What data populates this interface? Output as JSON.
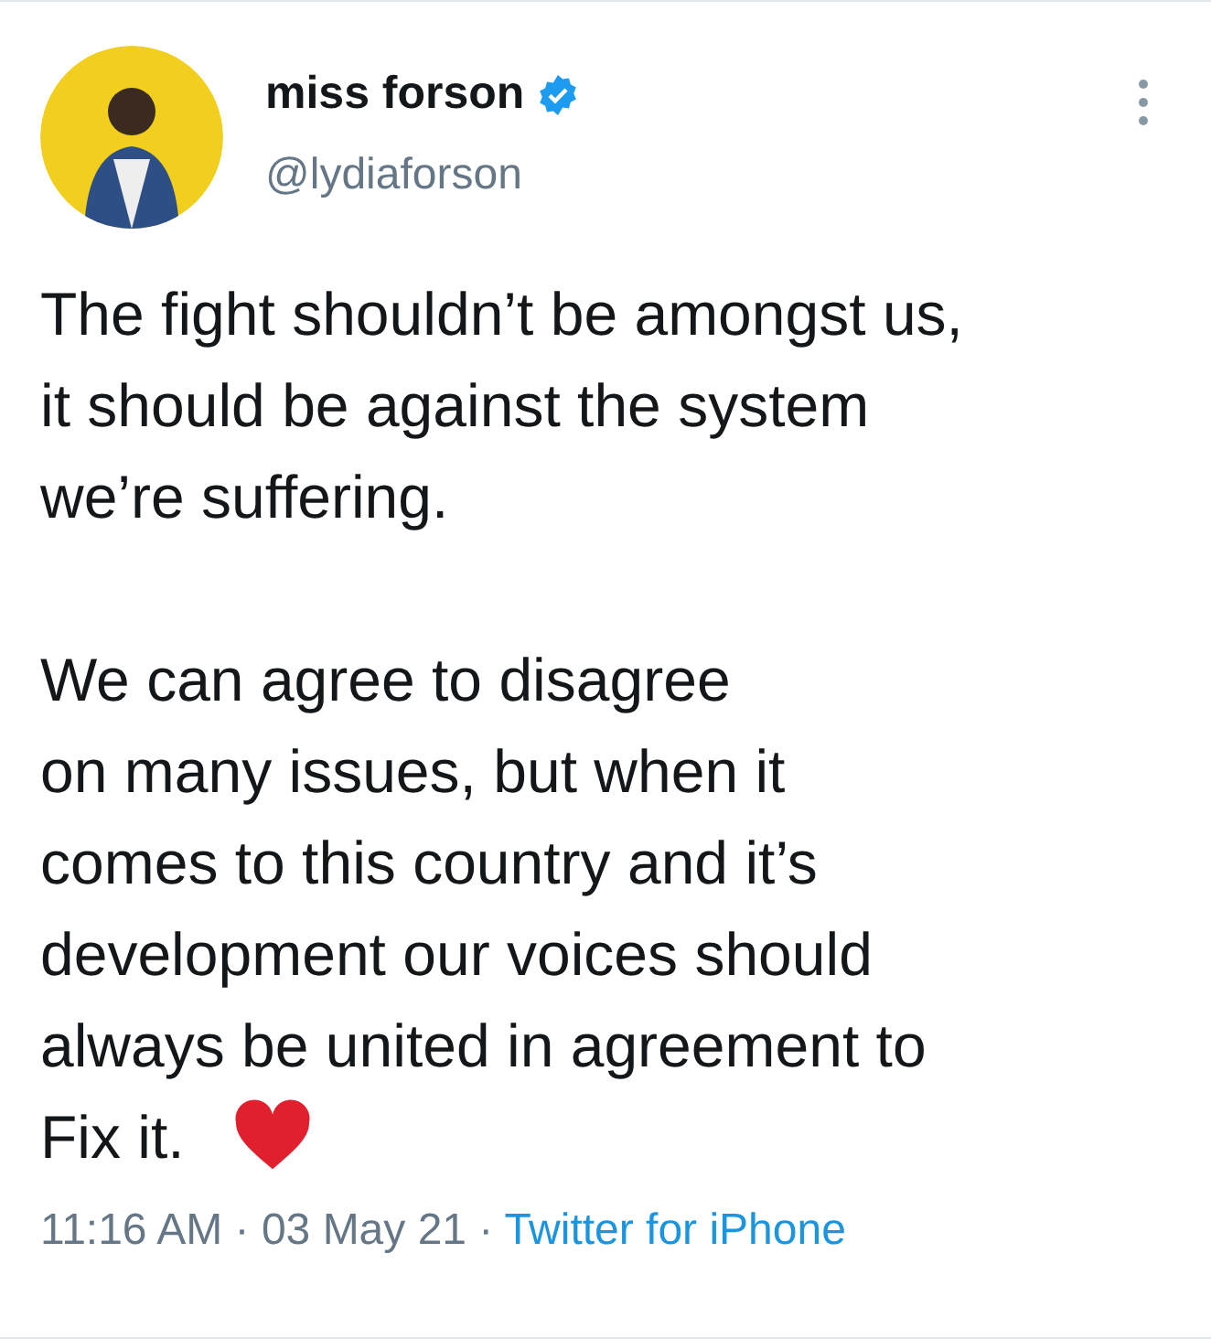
{
  "tweet": {
    "author": {
      "name": "miss forson",
      "verified": true,
      "handle": "@lydiaforson"
    },
    "paragraphs": [
      "The fight shouldn’t be amongst us,\nit should be against the system\nwe’re suffering.",
      "We can agree to disagree\non many issues, but when it\ncomes to this country and it’s\ndevelopment our voices should\nalways be united in agreement to\nFix it."
    ],
    "timestamp": "11:16 AM · 03 May 21 ·",
    "source": "Twitter for iPhone"
  }
}
